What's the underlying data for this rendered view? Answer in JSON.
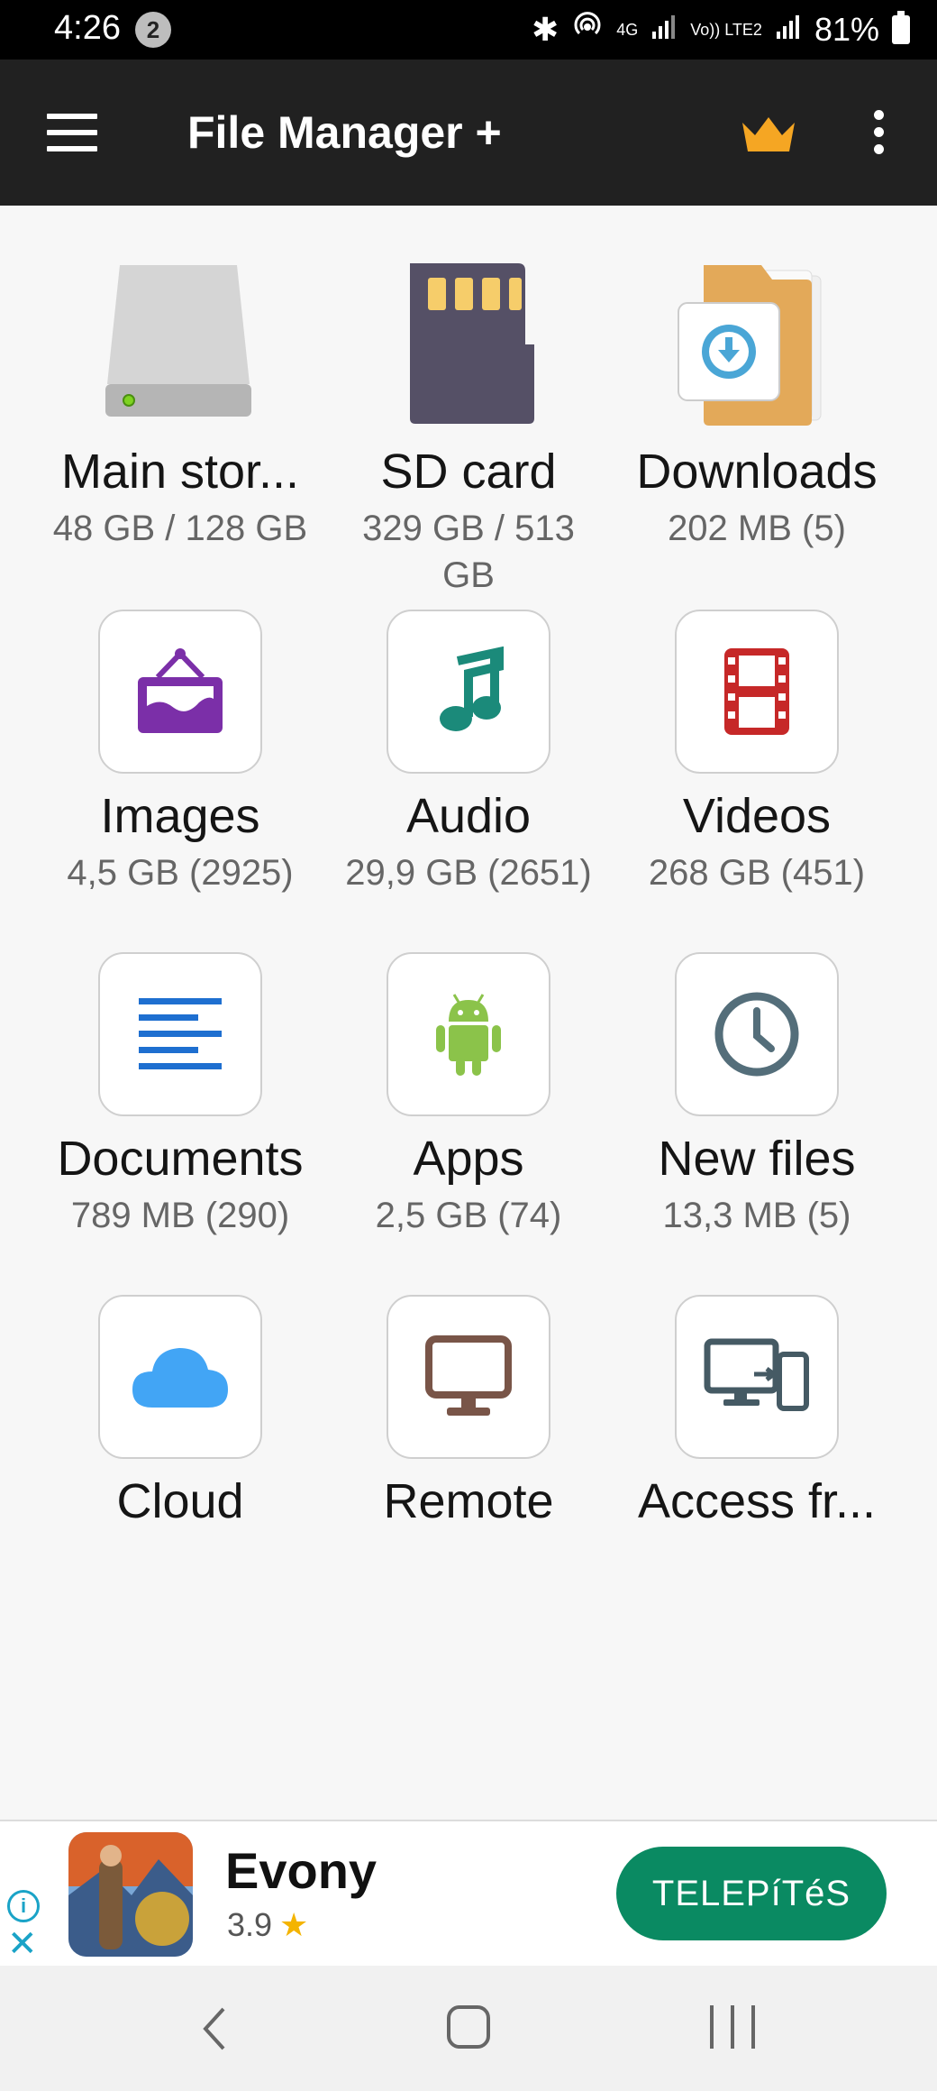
{
  "status_bar": {
    "time": "4:26",
    "notification_count": "2",
    "network_4g": "4G",
    "volte": "Vo)) LTE2",
    "battery": "81%"
  },
  "app_bar": {
    "title": "File Manager +"
  },
  "tiles": [
    {
      "label": "Main stor...",
      "sub": "48 GB / 128 GB",
      "icon": "storage-drive-icon"
    },
    {
      "label": "SD card",
      "sub": "329 GB / 513 GB",
      "icon": "sd-card-icon"
    },
    {
      "label": "Downloads",
      "sub": "202 MB (5)",
      "icon": "downloads-folder-icon"
    },
    {
      "label": "Images",
      "sub": "4,5 GB (2925)",
      "icon": "image-icon"
    },
    {
      "label": "Audio",
      "sub": "29,9 GB (2651)",
      "icon": "music-note-icon"
    },
    {
      "label": "Videos",
      "sub": "268 GB (451)",
      "icon": "film-icon"
    },
    {
      "label": "Documents",
      "sub": "789 MB (290)",
      "icon": "document-lines-icon"
    },
    {
      "label": "Apps",
      "sub": "2,5 GB (74)",
      "icon": "android-icon"
    },
    {
      "label": "New files",
      "sub": "13,3 MB (5)",
      "icon": "clock-icon"
    },
    {
      "label": "Cloud",
      "sub": "",
      "icon": "cloud-icon"
    },
    {
      "label": "Remote",
      "sub": "",
      "icon": "monitor-icon"
    },
    {
      "label": "Access fr...",
      "sub": "",
      "icon": "devices-icon"
    }
  ],
  "ad": {
    "app_name": "Evony",
    "rating": "3.9",
    "star": "★",
    "install_label": "TELEPíTéS",
    "info_glyph": "i",
    "close_glyph": "✕"
  },
  "colors": {
    "app_bar": "#212121",
    "crown": "#f5a623",
    "install_button": "#0a8a62",
    "images_purple": "#7b2fa8",
    "audio_teal": "#1b8a7a",
    "videos_red": "#c62828",
    "documents_blue": "#1e6fd0",
    "apps_green": "#8bc34a",
    "clock_slate": "#546e7a",
    "cloud_blue": "#42a5f5",
    "remote_brown": "#795548",
    "access_gray": "#455a64"
  }
}
